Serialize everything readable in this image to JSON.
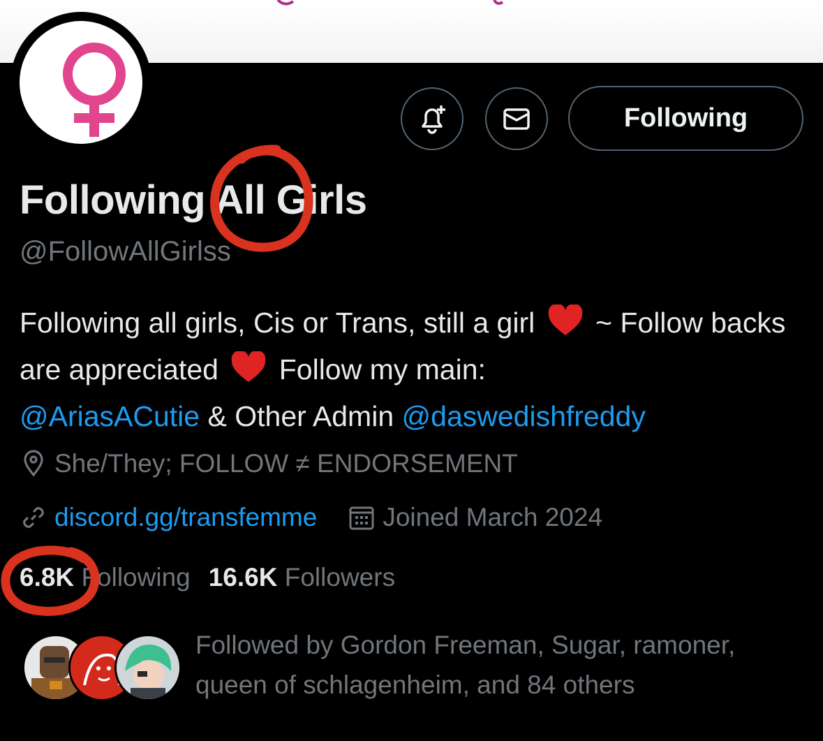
{
  "colors": {
    "background": "#000000",
    "text_primary": "#e7e9ea",
    "text_secondary": "#71767b",
    "link": "#1d9bf0",
    "button_border": "#536471",
    "avatar_symbol": "#e0458e",
    "annotation_red": "#d9331f"
  },
  "header": {
    "avatar_icon": "venus-symbol-icon",
    "buttons": {
      "notify_icon": "bell-plus-icon",
      "message_icon": "envelope-icon",
      "follow_state_label": "Following"
    }
  },
  "profile": {
    "display_name": "Following All Girls",
    "handle": "@FollowAllGirlss",
    "bio": {
      "part1": "Following all girls, Cis or Trans, still a girl",
      "part2": "~ Follow backs are appreciated",
      "part3": "Follow my main:",
      "mention1": "@AriasACutie",
      "part4": "& Other Admin",
      "mention2": "@daswedishfreddy"
    },
    "location": "She/They; FOLLOW ≠ ENDORSEMENT",
    "website": "discord.gg/transfemme",
    "joined": "Joined March 2024",
    "meta_icons": [
      "location-pin-icon",
      "link-icon",
      "calendar-icon"
    ]
  },
  "stats": {
    "following_count": "6.8K",
    "following_label": "Following",
    "followers_count": "16.6K",
    "followers_label": "Followers"
  },
  "followed_by": {
    "text": "Followed by Gordon Freeman, Sugar, ramoner, queen of schlagenheim, and 84 others"
  }
}
